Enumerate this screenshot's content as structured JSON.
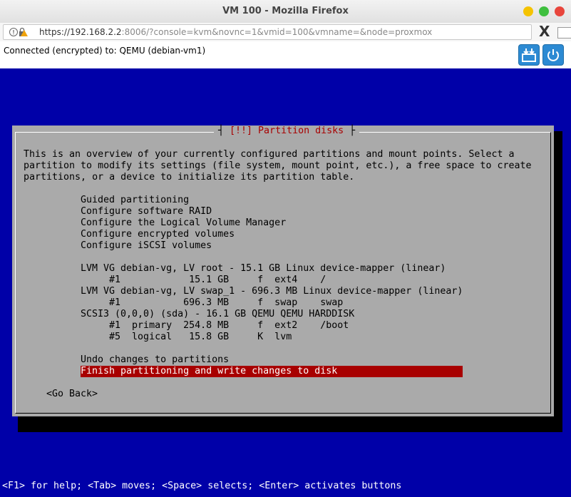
{
  "window": {
    "title": "VM 100 - Mozilla Firefox",
    "url_host": "https://192.168.2.2",
    "url_rest": ":8006/?console=kvm&novnc=1&vmid=100&vmname=&node=proxmox",
    "close_symbol": "X"
  },
  "novnc": {
    "status": "Connected (encrypted) to: QEMU (debian-vm1)"
  },
  "installer": {
    "title_left": "[!!] ",
    "title_text": "Partition disks",
    "intro_lines": [
      "This is an overview of your currently configured partitions and mount points. Select a",
      "partition to modify its settings (file system, mount point, etc.), a free space to create",
      "partitions, or a device to initialize its partition table."
    ],
    "menu_items": [
      "Guided partitioning",
      "Configure software RAID",
      "Configure the Logical Volume Manager",
      "Configure encrypted volumes",
      "Configure iSCSI volumes"
    ],
    "partition_lines": [
      "LVM VG debian-vg, LV root - 15.1 GB Linux device-mapper (linear)",
      "     #1            15.1 GB     f  ext4    /",
      "LVM VG debian-vg, LV swap_1 - 696.3 MB Linux device-mapper (linear)",
      "     #1           696.3 MB     f  swap    swap",
      "SCSI3 (0,0,0) (sda) - 16.1 GB QEMU QEMU HARDDISK",
      "     #1  primary  254.8 MB     f  ext2    /boot",
      "     #5  logical   15.8 GB     K  lvm"
    ],
    "undo": "Undo changes to partitions",
    "finish": "Finish partitioning and write changes to disk",
    "go_back": "<Go Back>",
    "footer": "<F1> for help; <Tab> moves; <Space> selects; <Enter> activates buttons"
  }
}
